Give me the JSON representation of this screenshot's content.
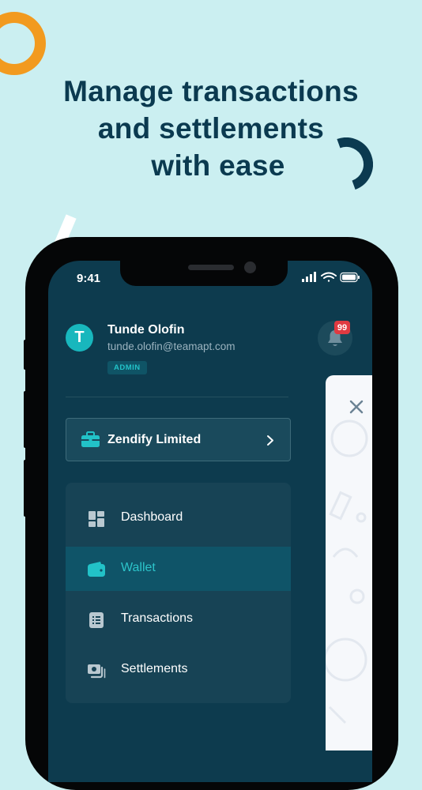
{
  "headline": {
    "line1": "Manage transactions",
    "line2": "and settlements",
    "line3": "with ease"
  },
  "status_bar": {
    "time": "9:41"
  },
  "profile": {
    "avatar_initial": "T",
    "name": "Tunde Olofin",
    "email": "tunde.olofin@teamapt.com",
    "role": "ADMIN"
  },
  "notifications": {
    "count": "99"
  },
  "organization": {
    "name": "Zendify Limited"
  },
  "menu": {
    "items": [
      {
        "label": "Dashboard",
        "icon": "dashboard-icon",
        "active": false
      },
      {
        "label": "Wallet",
        "icon": "wallet-icon",
        "active": true
      },
      {
        "label": "Transactions",
        "icon": "transactions-icon",
        "active": false
      },
      {
        "label": "Settlements",
        "icon": "settlements-icon",
        "active": false
      }
    ]
  },
  "colors": {
    "background": "#cbeff1",
    "headline": "#0b3a50",
    "drawer": "#0d3b4e",
    "accent": "#22c2c8",
    "ring": "#f29a1f",
    "badge": "#e03a41"
  }
}
